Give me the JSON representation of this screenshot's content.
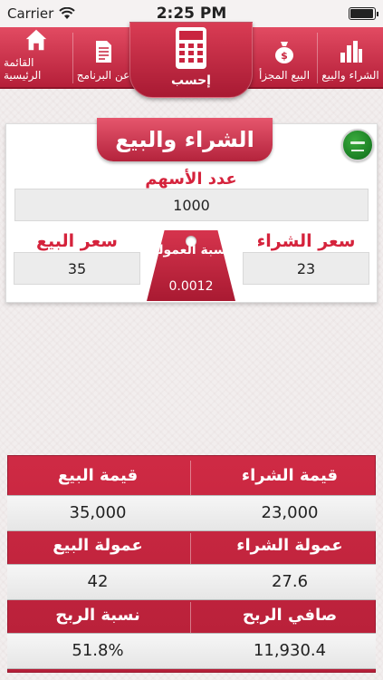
{
  "status_bar": {
    "carrier": "Carrier",
    "time": "2:25 PM",
    "battery_level": 0.95
  },
  "tabs": {
    "buy_sell": "الشراء والبيع",
    "profit_sale": "البيع المجزأ",
    "calculate": "إحسب",
    "about": "عن البرنامج",
    "home": "القائمة الرئيسية"
  },
  "card": {
    "title": "الشراء والبيع",
    "shares_label": "عدد الأسهم",
    "shares_value": "1000",
    "buy_price_label": "سعر الشراء",
    "buy_price_value": "23",
    "sell_price_label": "سعر البيع",
    "sell_price_value": "35",
    "commission_label": "نسبة العمولة",
    "commission_value": "0.0012"
  },
  "results": {
    "buy_value_label": "قيمة الشراء",
    "buy_value": "23,000",
    "sell_value_label": "قيمة البيع",
    "sell_value": "35,000",
    "buy_commission_label": "عمولة الشراء",
    "buy_commission": "27.6",
    "sell_commission_label": "عمولة البيع",
    "sell_commission": "42",
    "net_profit_label": "صافي الربح",
    "net_profit": "11,930.4",
    "profit_ratio_label": "نسبة الربح",
    "profit_ratio": "51.8%"
  },
  "colors": {
    "accent": "#c9253f",
    "dark_accent": "#a81a33"
  },
  "icons": {
    "buy_sell": "bar-chart-icon",
    "profit_sale": "money-bag-icon",
    "calculate": "calculator-icon",
    "about": "document-icon",
    "home": "home-icon",
    "flag": "saudi-flag-icon"
  }
}
